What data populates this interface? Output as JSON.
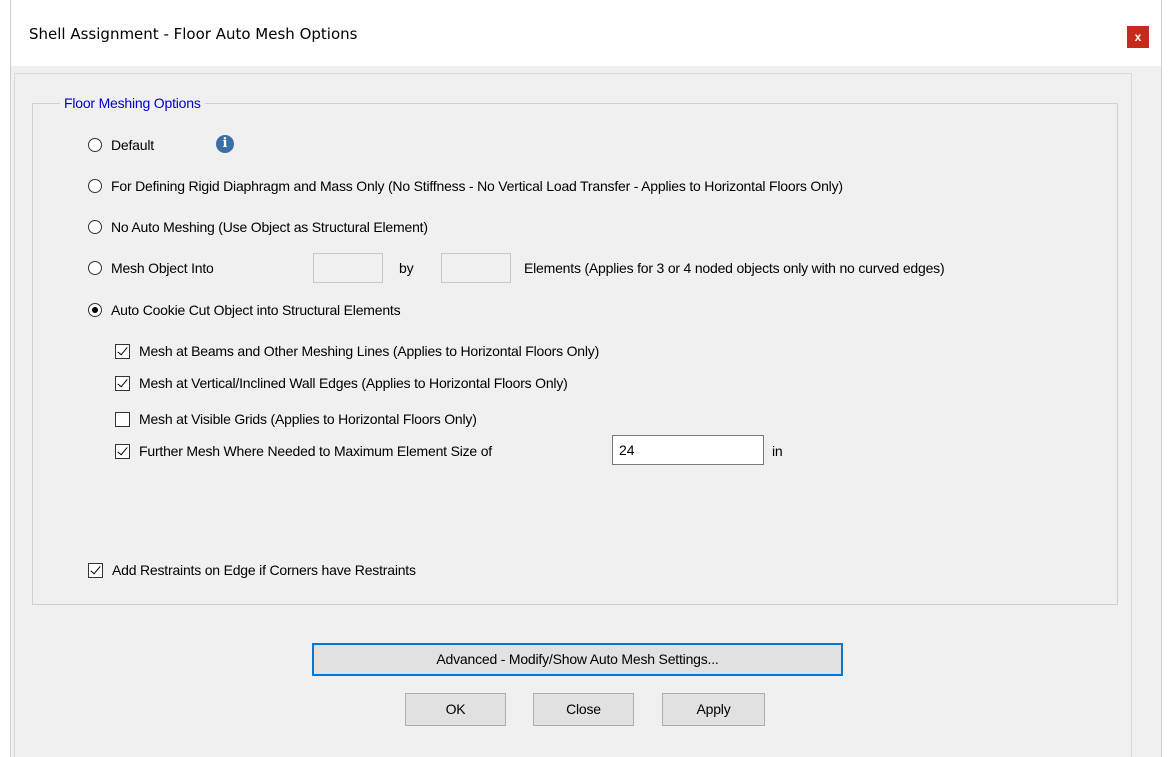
{
  "window": {
    "title": "Shell Assignment - Floor Auto Mesh Options",
    "close_glyph": "x"
  },
  "group": {
    "title": "Floor Meshing Options"
  },
  "options": {
    "default_label": "Default",
    "rigid_label": "For Defining Rigid Diaphragm and Mass Only  (No Stiffness - No Vertical Load Transfer - Applies to Horizontal Floors Only)",
    "no_auto_label": "No Auto Meshing  (Use Object as Structural Element)",
    "mesh_into_label": "Mesh Object Into",
    "mesh_into_by": "by",
    "mesh_into_n1": "",
    "mesh_into_n2": "",
    "mesh_into_suffix": "Elements (Applies for 3 or 4 noded objects only with no curved edges)",
    "cookie_cut_label": "Auto Cookie Cut Object into Structural Elements",
    "selected": "cookie_cut"
  },
  "sub_options": {
    "beams_label": "Mesh at Beams and Other Meshing Lines  (Applies to Horizontal Floors Only)",
    "beams_checked": true,
    "walls_label": "Mesh at Vertical/Inclined Wall Edges  (Applies to Horizontal Floors Only)",
    "walls_checked": true,
    "grids_label": "Mesh at Visible Grids  (Applies to Horizontal Floors Only)",
    "grids_checked": false,
    "further_label": "Further Mesh Where Needed to Maximum Element Size of",
    "further_checked": true,
    "max_size_value": "24",
    "max_size_unit": "in"
  },
  "restraints": {
    "label": "Add Restraints on Edge if Corners have Restraints",
    "checked": true
  },
  "buttons": {
    "advanced": "Advanced - Modify/Show Auto Mesh Settings...",
    "ok": "OK",
    "close": "Close",
    "apply": "Apply"
  },
  "icons": {
    "info": "info-icon",
    "close": "close-icon"
  },
  "colors": {
    "group_title": "#0000c8",
    "close_button": "#c42b1c",
    "focus_border": "#0078d7"
  }
}
